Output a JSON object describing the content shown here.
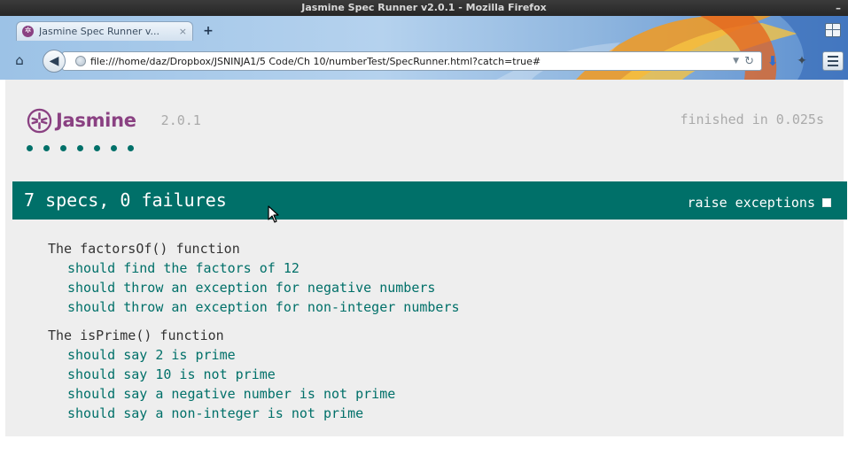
{
  "window": {
    "title": "Jasmine Spec Runner v2.0.1 - Mozilla Firefox",
    "minimize_glyph": "–"
  },
  "browser": {
    "tab": {
      "title": "Jasmine Spec Runner v...",
      "close_glyph": "×",
      "favicon_glyph": "✲"
    },
    "new_tab_glyph": "+",
    "url": "file:///home/daz/Dropbox/JSNINJA1/5 Code/Ch 10/numberTest/SpecRunner.html?catch=true#",
    "icons": {
      "home": "home-icon",
      "back": "back-arrow-icon",
      "globe": "globe-icon",
      "reload": "reload-icon",
      "download": "download-icon",
      "addon": "addon-icon",
      "menu": "hamburger-menu-icon",
      "tab_groups": "tab-groups-icon"
    },
    "glyphs": {
      "home": "⌂",
      "back": "◀",
      "dropdown": "▼",
      "reload": "↻",
      "download": "⬇",
      "addon": "✦"
    }
  },
  "jasmine": {
    "logo_text": "Jasmine",
    "version": "2.0.1",
    "duration": "finished in 0.025s",
    "passed_dots": 7,
    "summary": "7 specs, 0 failures",
    "raise_exceptions_label": "raise exceptions",
    "raise_exceptions_checked": false,
    "colors": {
      "brand": "#8a4182",
      "passed": "#007069",
      "background": "#eeeeee",
      "suite_text": "#333333",
      "muted_text": "#aaaaaa"
    },
    "suites": [
      {
        "name": "The factorsOf() function",
        "specs": [
          "should find the factors of 12",
          "should throw an exception for negative numbers",
          "should throw an exception for non-integer numbers"
        ]
      },
      {
        "name": "The isPrime() function",
        "specs": [
          "should say 2 is prime",
          "should say 10 is not prime",
          "should say a negative number is not prime",
          "should say a non-integer is not prime"
        ]
      }
    ]
  }
}
